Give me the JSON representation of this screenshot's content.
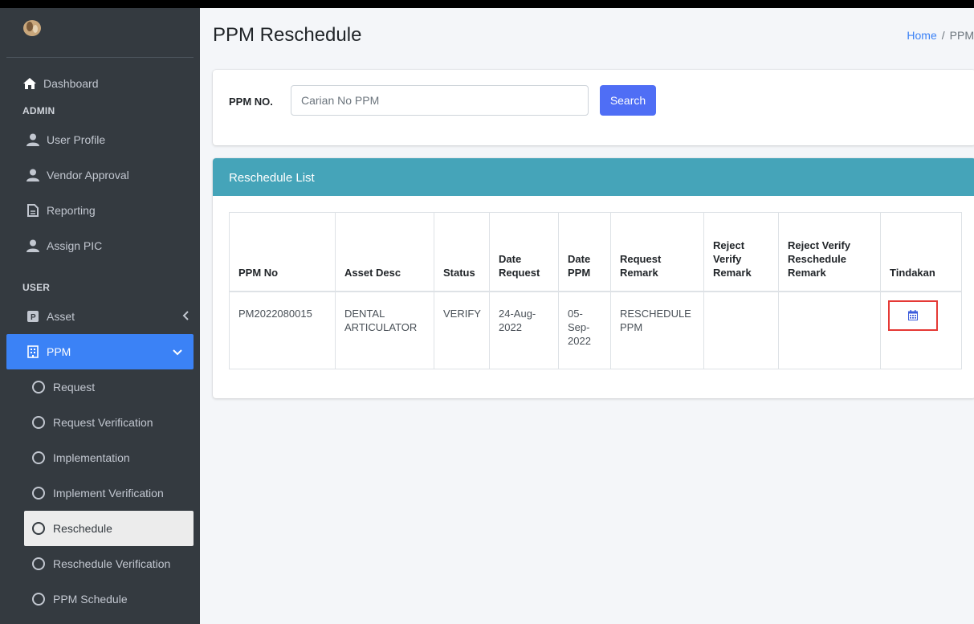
{
  "sidebar": {
    "dashboard": "Dashboard",
    "admin_header": "ADMIN",
    "admin_items": [
      "User Profile",
      "Vendor Approval",
      "Reporting",
      "Assign PIC"
    ],
    "user_header": "USER",
    "asset": "Asset",
    "ppm": "PPM",
    "ppm_sub": [
      "Request",
      "Request Verification",
      "Implementation",
      "Implement Verification",
      "Reschedule",
      "Reschedule Verification",
      "PPM Schedule"
    ]
  },
  "page": {
    "title": "PPM Reschedule",
    "breadcrumb_home": "Home",
    "breadcrumb_sep": "/",
    "breadcrumb_current": "PPM"
  },
  "search": {
    "label": "PPM NO.",
    "placeholder": "Carian No PPM",
    "button": "Search"
  },
  "list": {
    "header": "Reschedule List",
    "columns": [
      "PPM No",
      "Asset Desc",
      "Status",
      "Date Request",
      "Date PPM",
      "Request Remark",
      "Reject Verify Remark",
      "Reject Verify Reschedule Remark",
      "Tindakan"
    ],
    "row": {
      "ppm_no": "PM2022080015",
      "asset_desc": "DENTAL ARTICULATOR",
      "status": "VERIFY",
      "date_request": "24-Aug-2022",
      "date_ppm": "05-Sep-2022",
      "request_remark": "RESCHEDULE PPM",
      "reject_verify_remark": "",
      "reject_verify_reschedule_remark": ""
    }
  },
  "colors": {
    "sidebar_bg": "#343a40",
    "active": "#3b82f6",
    "card_header": "#45a4b9",
    "action_highlight": "#e53935"
  }
}
